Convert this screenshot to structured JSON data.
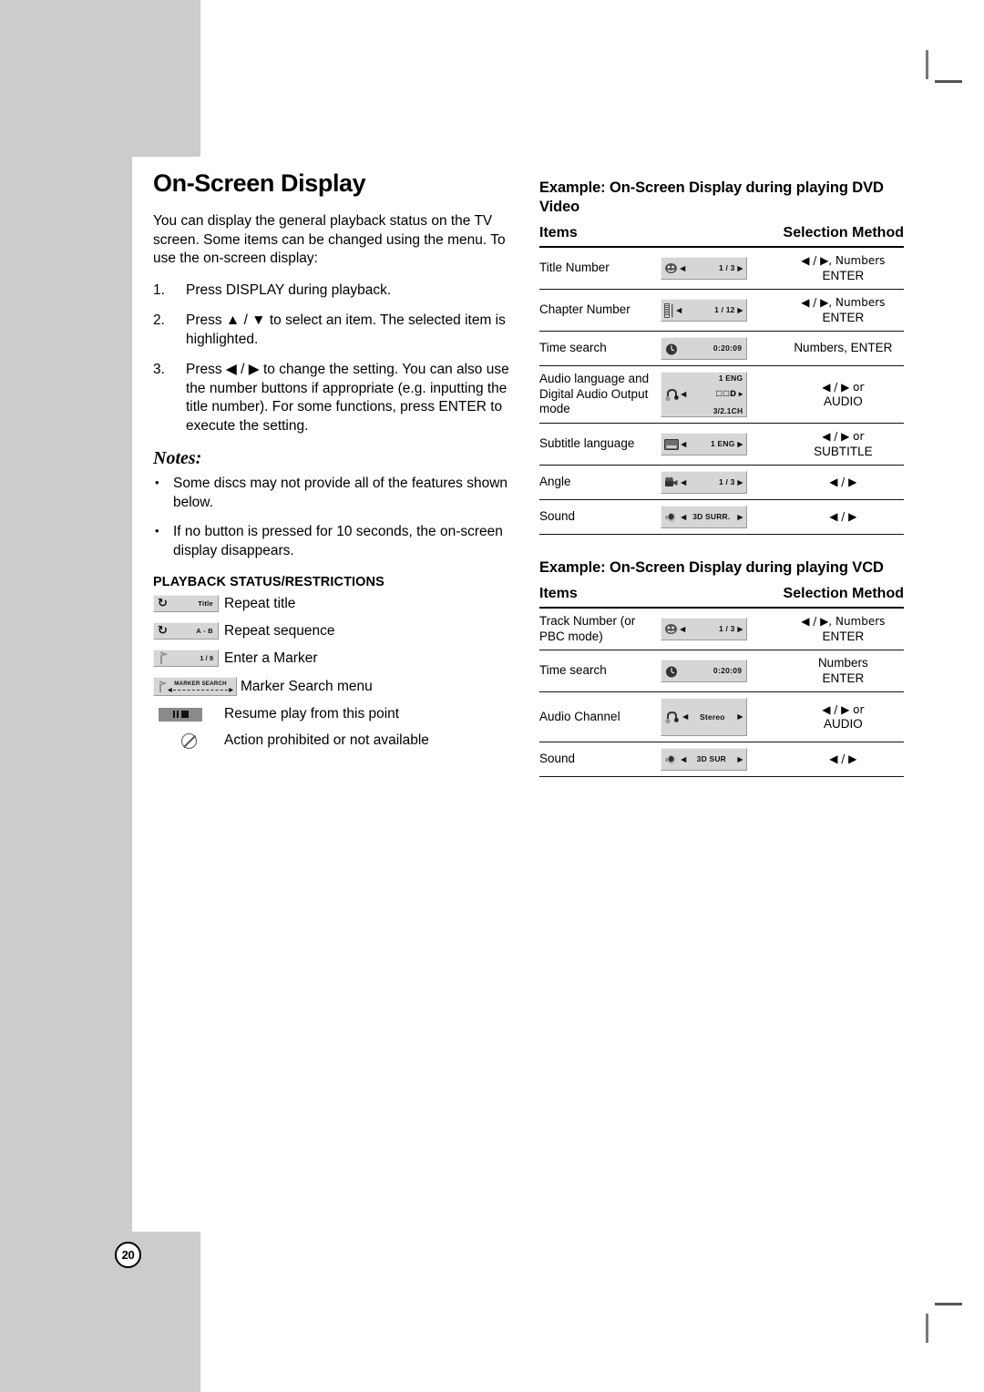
{
  "page": {
    "number": "20"
  },
  "left": {
    "title": "On-Screen Display",
    "intro": "You can display the general playback status on the TV screen. Some items can be changed using the menu. To use the on-screen display:",
    "steps": [
      {
        "num": "1.",
        "text": "Press DISPLAY during playback."
      },
      {
        "num": "2.",
        "text": "Press ▲ / ▼ to select an item. The selected item is highlighted."
      },
      {
        "num": "3.",
        "text": "Press ◀ / ▶ to change the setting. You can also use the number buttons if appropriate (e.g. inputting the title number). For some functions, press ENTER to execute the setting."
      }
    ],
    "notes_heading": "Notes:",
    "notes": [
      "Some discs may not provide all of the features shown below.",
      "If no button is pressed for 10 seconds, the on-screen display disappears."
    ],
    "playback_status_heading": "PLAYBACK STATUS/RESTRICTIONS",
    "playback_status": [
      {
        "icon": "repeat-icon",
        "chip_value": "Title",
        "label": "Repeat title"
      },
      {
        "icon": "repeat-icon",
        "chip_value": "A - B",
        "label": "Repeat sequence"
      },
      {
        "icon": "marker-icon",
        "chip_value": "1 / 9",
        "label": "Enter a Marker"
      },
      {
        "icon": "marker-search-icon",
        "chip_value": "MARKER SEARCH",
        "label": "Marker Search menu"
      },
      {
        "icon": "resume-icon",
        "chip_value": "",
        "label": "Resume play from this point"
      },
      {
        "icon": "prohibited-icon",
        "chip_value": "",
        "label": "Action prohibited or not available"
      }
    ]
  },
  "right": {
    "dvd": {
      "heading": "Example: On-Screen Display during playing DVD Video",
      "col_items": "Items",
      "col_method": "Selection Method",
      "rows": [
        {
          "item": "Title Number",
          "icon": "disc-title-icon",
          "badge_value": "1 / 3",
          "badge_arrows": "both",
          "method_line1": "◀ / ▶, Numbers",
          "method_line2": "ENTER"
        },
        {
          "item": "Chapter Number",
          "icon": "film-chapter-icon",
          "badge_value": "1 / 12",
          "badge_arrows": "both",
          "method_line1": "◀ / ▶, Numbers",
          "method_line2": "ENTER"
        },
        {
          "item": "Time search",
          "icon": "clock-icon",
          "badge_value": "0:20:09",
          "badge_arrows": "none",
          "method_line1": "Numbers, ENTER",
          "method_line2": ""
        },
        {
          "item": "Audio language and Digital Audio Output mode",
          "icon": "audio-icon",
          "badge_value": "1 ENG",
          "badge_value2": "☐☐D",
          "badge_value3": "3/2.1CH",
          "badge_arrows": "both",
          "method_line1": "◀ / ▶ or",
          "method_line2": "AUDIO"
        },
        {
          "item": "Subtitle language",
          "icon": "subtitle-icon",
          "badge_value": "1 ENG",
          "badge_arrows": "both",
          "method_line1": "◀ / ▶ or",
          "method_line2": "SUBTITLE"
        },
        {
          "item": "Angle",
          "icon": "camera-angle-icon",
          "badge_value": "1 / 3",
          "badge_arrows": "both",
          "method_line1": "◀ / ▶",
          "method_line2": ""
        },
        {
          "item": "Sound",
          "icon": "speaker-icon",
          "badge_value": "3D SURR.",
          "badge_arrows": "both",
          "method_line1": "◀ / ▶",
          "method_line2": ""
        }
      ]
    },
    "vcd": {
      "heading": "Example: On-Screen Display during playing VCD",
      "col_items": "Items",
      "col_method": "Selection Method",
      "rows": [
        {
          "item": "Track Number (or PBC mode)",
          "icon": "disc-title-icon",
          "badge_value": "1 / 3",
          "badge_arrows": "both",
          "method_line1": "◀ / ▶, Numbers",
          "method_line2": "ENTER"
        },
        {
          "item": "Time search",
          "icon": "clock-icon",
          "badge_value": "0:20:09",
          "badge_arrows": "none",
          "method_line1": "Numbers",
          "method_line2": "ENTER"
        },
        {
          "item": "Audio Channel",
          "icon": "audio-icon",
          "badge_value": "Stereo",
          "badge_arrows": "both",
          "method_line1": "◀ / ▶ or",
          "method_line2": "AUDIO"
        },
        {
          "item": "Sound",
          "icon": "speaker-icon",
          "badge_value": "3D SUR",
          "badge_arrows": "both",
          "method_line1": "◀ / ▶",
          "method_line2": ""
        }
      ]
    }
  }
}
